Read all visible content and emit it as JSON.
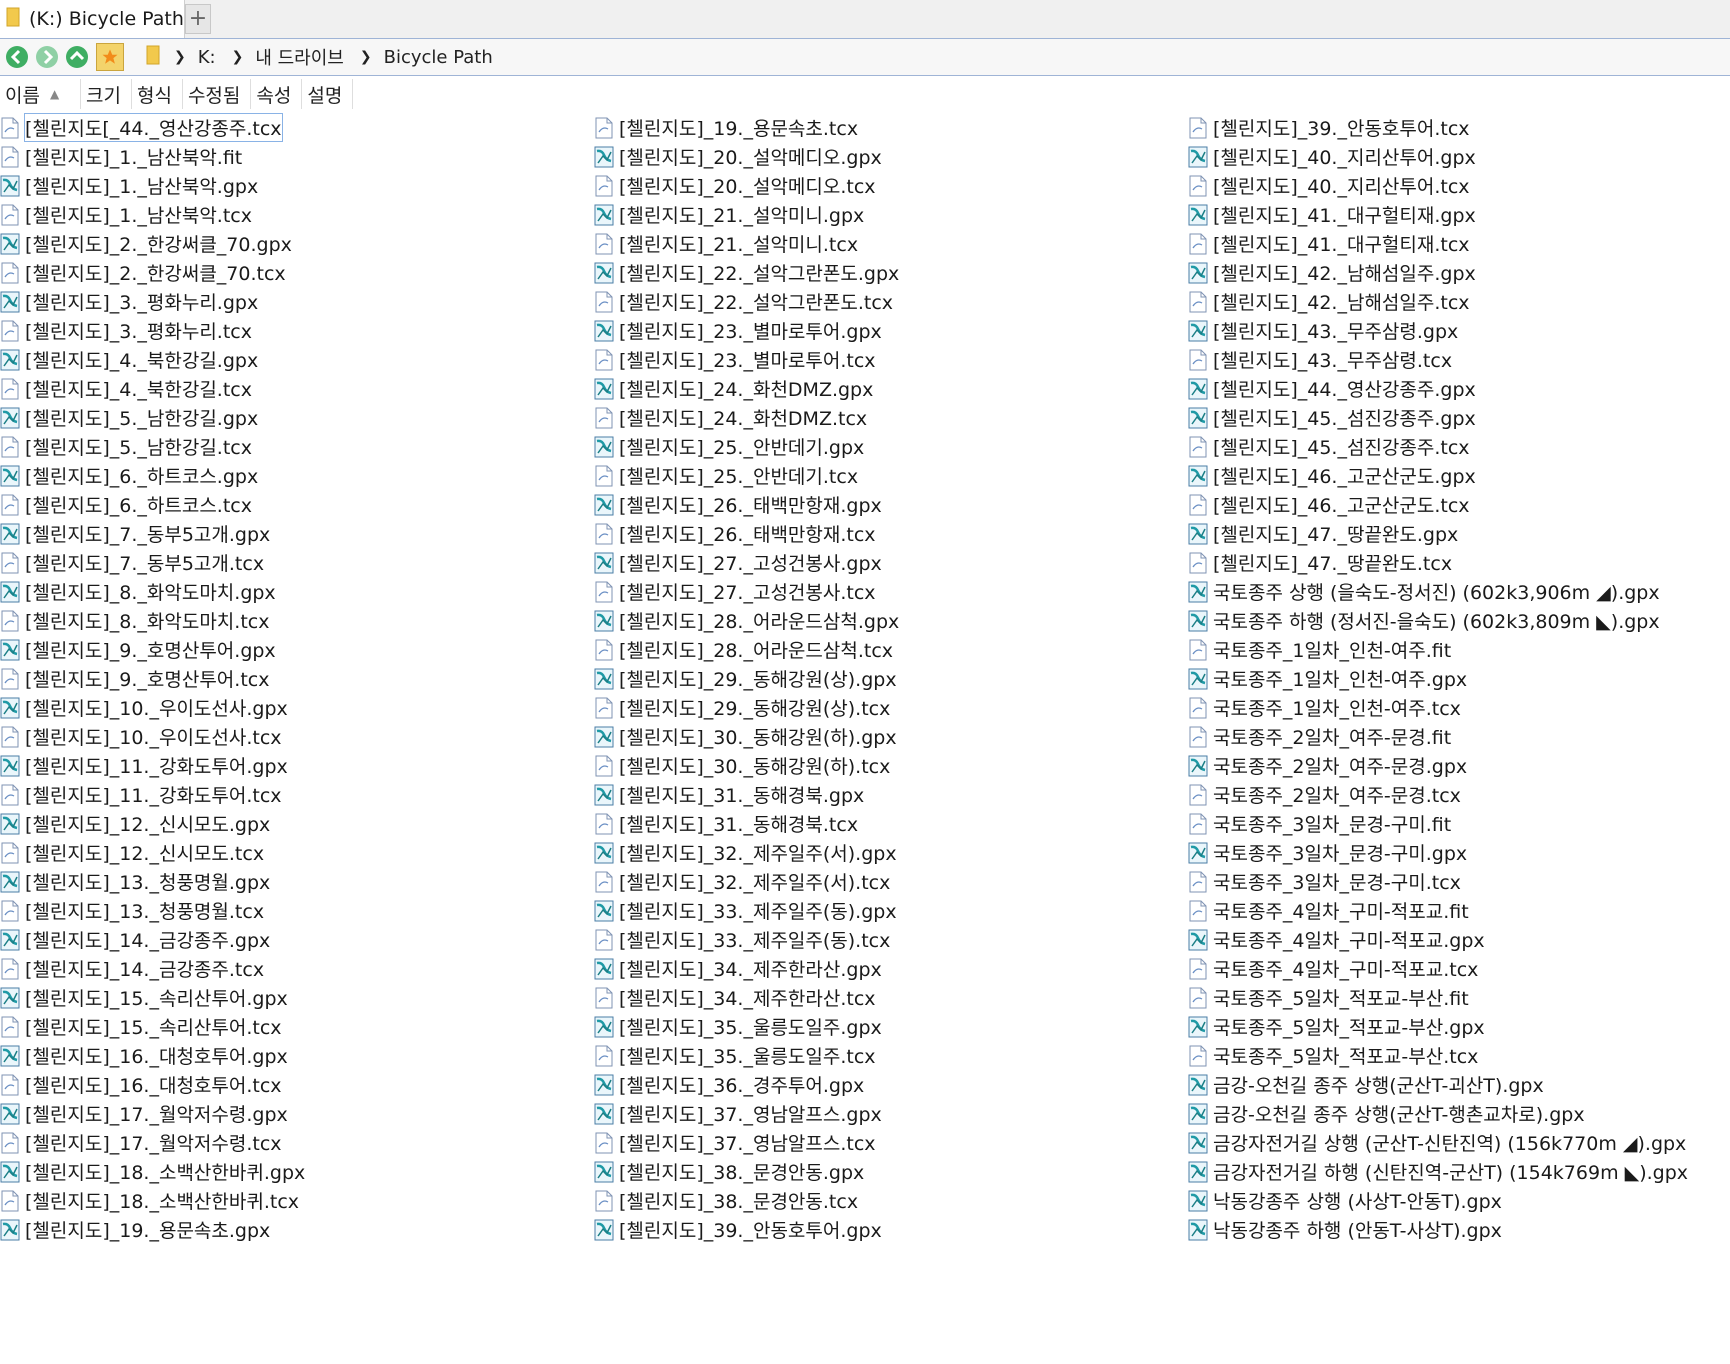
{
  "tab": {
    "title": "(K:) Bicycle Path",
    "new_tab": "+"
  },
  "breadcrumb": {
    "items": [
      "K:",
      "내 드라이브",
      "Bicycle Path"
    ]
  },
  "columns": [
    "이름",
    "크기",
    "형식",
    "수정됨",
    "속성",
    "설명"
  ],
  "sort_column": "이름",
  "colors": {
    "accent_bar": "#9fb4d6",
    "nav_green": "#3fae63",
    "gpx_icon": "#1f9aa6"
  },
  "files": {
    "col1": [
      {
        "name": "[첼린지도[_44._영산강종주.tcx",
        "type": "tcx"
      },
      {
        "name": "[첼린지도]_1._남산북악.fit",
        "type": "fit"
      },
      {
        "name": "[첼린지도]_1._남산북악.gpx",
        "type": "gpx"
      },
      {
        "name": "[첼린지도]_1._남산북악.tcx",
        "type": "tcx"
      },
      {
        "name": "[첼린지도]_2._한강써클_70.gpx",
        "type": "gpx"
      },
      {
        "name": "[첼린지도]_2._한강써클_70.tcx",
        "type": "tcx"
      },
      {
        "name": "[첼린지도]_3._평화누리.gpx",
        "type": "gpx"
      },
      {
        "name": "[첼린지도]_3._평화누리.tcx",
        "type": "tcx"
      },
      {
        "name": "[첼린지도]_4._북한강길.gpx",
        "type": "gpx"
      },
      {
        "name": "[첼린지도]_4._북한강길.tcx",
        "type": "tcx"
      },
      {
        "name": "[첼린지도]_5._남한강길.gpx",
        "type": "gpx"
      },
      {
        "name": "[첼린지도]_5._남한강길.tcx",
        "type": "tcx"
      },
      {
        "name": "[첼린지도]_6._하트코스.gpx",
        "type": "gpx"
      },
      {
        "name": "[첼린지도]_6._하트코스.tcx",
        "type": "tcx"
      },
      {
        "name": "[첼린지도]_7._동부5고개.gpx",
        "type": "gpx"
      },
      {
        "name": "[첼린지도]_7._동부5고개.tcx",
        "type": "tcx"
      },
      {
        "name": "[첼린지도]_8._화악도마치.gpx",
        "type": "gpx"
      },
      {
        "name": "[첼린지도]_8._화악도마치.tcx",
        "type": "tcx"
      },
      {
        "name": "[첼린지도]_9._호명산투어.gpx",
        "type": "gpx"
      },
      {
        "name": "[첼린지도]_9._호명산투어.tcx",
        "type": "tcx"
      },
      {
        "name": "[첼린지도]_10._우이도선사.gpx",
        "type": "gpx"
      },
      {
        "name": "[첼린지도]_10._우이도선사.tcx",
        "type": "tcx"
      },
      {
        "name": "[첼린지도]_11._강화도투어.gpx",
        "type": "gpx"
      },
      {
        "name": "[첼린지도]_11._강화도투어.tcx",
        "type": "tcx"
      },
      {
        "name": "[첼린지도]_12._신시모도.gpx",
        "type": "gpx"
      },
      {
        "name": "[첼린지도]_12._신시모도.tcx",
        "type": "tcx"
      },
      {
        "name": "[첼린지도]_13._청풍명월.gpx",
        "type": "gpx"
      },
      {
        "name": "[첼린지도]_13._청풍명월.tcx",
        "type": "tcx"
      },
      {
        "name": "[첼린지도]_14._금강종주.gpx",
        "type": "gpx"
      },
      {
        "name": "[첼린지도]_14._금강종주.tcx",
        "type": "tcx"
      },
      {
        "name": "[첼린지도]_15._속리산투어.gpx",
        "type": "gpx"
      },
      {
        "name": "[첼린지도]_15._속리산투어.tcx",
        "type": "tcx"
      },
      {
        "name": "[첼린지도]_16._대청호투어.gpx",
        "type": "gpx"
      },
      {
        "name": "[첼린지도]_16._대청호투어.tcx",
        "type": "tcx"
      },
      {
        "name": "[첼린지도]_17._월악저수령.gpx",
        "type": "gpx"
      },
      {
        "name": "[첼린지도]_17._월악저수령.tcx",
        "type": "tcx"
      },
      {
        "name": "[첼린지도]_18._소백산한바퀴.gpx",
        "type": "gpx"
      },
      {
        "name": "[첼린지도]_18._소백산한바퀴.tcx",
        "type": "tcx"
      },
      {
        "name": "[첼린지도]_19._용문속초.gpx",
        "type": "gpx"
      }
    ],
    "col2": [
      {
        "name": "[첼린지도]_19._용문속초.tcx",
        "type": "tcx"
      },
      {
        "name": "[첼린지도]_20._설악메디오.gpx",
        "type": "gpx"
      },
      {
        "name": "[첼린지도]_20._설악메디오.tcx",
        "type": "tcx"
      },
      {
        "name": "[첼린지도]_21._설악미니.gpx",
        "type": "gpx"
      },
      {
        "name": "[첼린지도]_21._설악미니.tcx",
        "type": "tcx"
      },
      {
        "name": "[첼린지도]_22._설악그란폰도.gpx",
        "type": "gpx"
      },
      {
        "name": "[첼린지도]_22._설악그란폰도.tcx",
        "type": "tcx"
      },
      {
        "name": "[첼린지도]_23._별마로투어.gpx",
        "type": "gpx"
      },
      {
        "name": "[첼린지도]_23._별마로투어.tcx",
        "type": "tcx"
      },
      {
        "name": "[첼린지도]_24._화천DMZ.gpx",
        "type": "gpx"
      },
      {
        "name": "[첼린지도]_24._화천DMZ.tcx",
        "type": "tcx"
      },
      {
        "name": "[첼린지도]_25._안반데기.gpx",
        "type": "gpx"
      },
      {
        "name": "[첼린지도]_25._안반데기.tcx",
        "type": "tcx"
      },
      {
        "name": "[첼린지도]_26._태백만항재.gpx",
        "type": "gpx"
      },
      {
        "name": "[첼린지도]_26._태백만항재.tcx",
        "type": "tcx"
      },
      {
        "name": "[첼린지도]_27._고성건봉사.gpx",
        "type": "gpx"
      },
      {
        "name": "[첼린지도]_27._고성건봉사.tcx",
        "type": "tcx"
      },
      {
        "name": "[첼린지도]_28._어라운드삼척.gpx",
        "type": "gpx"
      },
      {
        "name": "[첼린지도]_28._어라운드삼척.tcx",
        "type": "tcx"
      },
      {
        "name": "[첼린지도]_29._동해강원(상).gpx",
        "type": "gpx"
      },
      {
        "name": "[첼린지도]_29._동해강원(상).tcx",
        "type": "tcx"
      },
      {
        "name": "[첼린지도]_30._동해강원(하).gpx",
        "type": "gpx"
      },
      {
        "name": "[첼린지도]_30._동해강원(하).tcx",
        "type": "tcx"
      },
      {
        "name": "[첼린지도]_31._동해경북.gpx",
        "type": "gpx"
      },
      {
        "name": "[첼린지도]_31._동해경북.tcx",
        "type": "tcx"
      },
      {
        "name": "[첼린지도]_32._제주일주(서).gpx",
        "type": "gpx"
      },
      {
        "name": "[첼린지도]_32._제주일주(서).tcx",
        "type": "tcx"
      },
      {
        "name": "[첼린지도]_33._제주일주(동).gpx",
        "type": "gpx"
      },
      {
        "name": "[첼린지도]_33._제주일주(동).tcx",
        "type": "tcx"
      },
      {
        "name": "[첼린지도]_34._제주한라산.gpx",
        "type": "gpx"
      },
      {
        "name": "[첼린지도]_34._제주한라산.tcx",
        "type": "tcx"
      },
      {
        "name": "[첼린지도]_35._울릉도일주.gpx",
        "type": "gpx"
      },
      {
        "name": "[첼린지도]_35._울릉도일주.tcx",
        "type": "tcx"
      },
      {
        "name": "[첼린지도]_36._경주투어.gpx",
        "type": "gpx"
      },
      {
        "name": "[첼린지도]_37._영남알프스.gpx",
        "type": "gpx"
      },
      {
        "name": "[첼린지도]_37._영남알프스.tcx",
        "type": "tcx"
      },
      {
        "name": "[첼린지도]_38._문경안동.gpx",
        "type": "gpx"
      },
      {
        "name": "[첼린지도]_38._문경안동.tcx",
        "type": "tcx"
      },
      {
        "name": "[첼린지도]_39._안동호투어.gpx",
        "type": "gpx"
      }
    ],
    "col3": [
      {
        "name": "[첼린지도]_39._안동호투어.tcx",
        "type": "tcx"
      },
      {
        "name": "[첼린지도]_40._지리산투어.gpx",
        "type": "gpx"
      },
      {
        "name": "[첼린지도]_40._지리산투어.tcx",
        "type": "tcx"
      },
      {
        "name": "[첼린지도]_41._대구헐티재.gpx",
        "type": "gpx"
      },
      {
        "name": "[첼린지도]_41._대구헐티재.tcx",
        "type": "tcx"
      },
      {
        "name": "[첼린지도]_42._남해섬일주.gpx",
        "type": "gpx"
      },
      {
        "name": "[첼린지도]_42._남해섬일주.tcx",
        "type": "tcx"
      },
      {
        "name": "[첼린지도]_43._무주삼령.gpx",
        "type": "gpx"
      },
      {
        "name": "[첼린지도]_43._무주삼령.tcx",
        "type": "tcx"
      },
      {
        "name": "[첼린지도]_44._영산강종주.gpx",
        "type": "gpx"
      },
      {
        "name": "[첼린지도]_45._섬진강종주.gpx",
        "type": "gpx"
      },
      {
        "name": "[첼린지도]_45._섬진강종주.tcx",
        "type": "tcx"
      },
      {
        "name": "[첼린지도]_46._고군산군도.gpx",
        "type": "gpx"
      },
      {
        "name": "[첼린지도]_46._고군산군도.tcx",
        "type": "tcx"
      },
      {
        "name": "[첼린지도]_47._땅끝완도.gpx",
        "type": "gpx"
      },
      {
        "name": "[첼린지도]_47._땅끝완도.tcx",
        "type": "tcx"
      },
      {
        "name": "국토종주 상행 (을숙도-정서진) (602k3,906m ◢).gpx",
        "type": "gpx"
      },
      {
        "name": "국토종주 하행 (정서진-을숙도) (602k3,809m ◣).gpx",
        "type": "gpx"
      },
      {
        "name": "국토종주_1일차_인천-여주.fit",
        "type": "fit"
      },
      {
        "name": "국토종주_1일차_인천-여주.gpx",
        "type": "gpx"
      },
      {
        "name": "국토종주_1일차_인천-여주.tcx",
        "type": "tcx"
      },
      {
        "name": "국토종주_2일차_여주-문경.fit",
        "type": "fit"
      },
      {
        "name": "국토종주_2일차_여주-문경.gpx",
        "type": "gpx"
      },
      {
        "name": "국토종주_2일차_여주-문경.tcx",
        "type": "tcx"
      },
      {
        "name": "국토종주_3일차_문경-구미.fit",
        "type": "fit"
      },
      {
        "name": "국토종주_3일차_문경-구미.gpx",
        "type": "gpx"
      },
      {
        "name": "국토종주_3일차_문경-구미.tcx",
        "type": "tcx"
      },
      {
        "name": "국토종주_4일차_구미-적포교.fit",
        "type": "fit"
      },
      {
        "name": "국토종주_4일차_구미-적포교.gpx",
        "type": "gpx"
      },
      {
        "name": "국토종주_4일차_구미-적포교.tcx",
        "type": "tcx"
      },
      {
        "name": "국토종주_5일차_적포교-부산.fit",
        "type": "fit"
      },
      {
        "name": "국토종주_5일차_적포교-부산.gpx",
        "type": "gpx"
      },
      {
        "name": "국토종주_5일차_적포교-부산.tcx",
        "type": "tcx"
      },
      {
        "name": "금강-오천길 종주 상행(군산T-괴산T).gpx",
        "type": "gpx"
      },
      {
        "name": "금강-오천길 종주 상행(군산T-행촌교차로).gpx",
        "type": "gpx"
      },
      {
        "name": "금강자전거길 상행 (군산T-신탄진역) (156k770m ◢).gpx",
        "type": "gpx"
      },
      {
        "name": "금강자전거길 하행 (신탄진역-군산T) (154k769m ◣).gpx",
        "type": "gpx"
      },
      {
        "name": "낙동강종주 상행 (사상T-안동T).gpx",
        "type": "gpx"
      },
      {
        "name": "낙동강종주 하행 (안동T-사상T).gpx",
        "type": "gpx"
      }
    ]
  }
}
